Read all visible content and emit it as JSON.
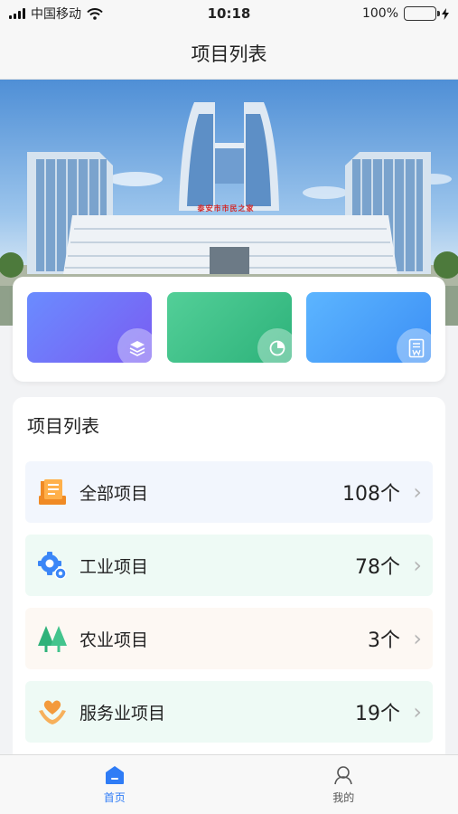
{
  "status_bar": {
    "carrier": "中国移动",
    "time": "10:18",
    "battery": "100%",
    "battery_level": 1.0
  },
  "nav": {
    "title": "项目列表"
  },
  "banner": {
    "sign_text": "泰安市市民之家"
  },
  "quick_tiles": [
    {
      "icon": "layers-icon",
      "color": "#6d7ffa"
    },
    {
      "icon": "pie-chart-icon",
      "color": "#3fc08a"
    },
    {
      "icon": "document-w-icon",
      "color": "#4aa2fa"
    }
  ],
  "project_list": {
    "title": "项目列表",
    "items": [
      {
        "label": "全部项目",
        "count": "108个",
        "icon": "folder-list-icon",
        "bg": "#f2f6fd"
      },
      {
        "label": "工业项目",
        "count": "78个",
        "icon": "gear-icon",
        "bg": "#eefaf5"
      },
      {
        "label": "农业项目",
        "count": "3个",
        "icon": "trees-icon",
        "bg": "#fdf8f3"
      },
      {
        "label": "服务业项目",
        "count": "19个",
        "icon": "hand-heart-icon",
        "bg": "#eefaf5"
      }
    ]
  },
  "tabbar": {
    "items": [
      {
        "label": "首页",
        "icon": "home-icon",
        "active": true
      },
      {
        "label": "我的",
        "icon": "user-icon",
        "active": false
      }
    ]
  }
}
